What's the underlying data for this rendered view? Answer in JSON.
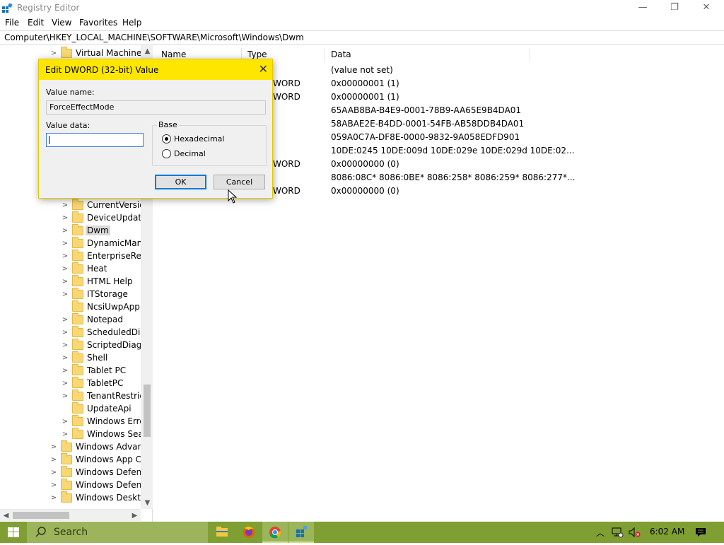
{
  "window": {
    "title": "Registry Editor",
    "controls": {
      "minimize": "—",
      "restore": "❐",
      "close": "✕"
    }
  },
  "menu": [
    "File",
    "Edit",
    "View",
    "Favorites",
    "Help"
  ],
  "address": "Computer\\HKEY_LOCAL_MACHINE\\SOFTWARE\\Microsoft\\Windows\\Dwm",
  "tree": {
    "top_item": "Virtual Machine",
    "items": [
      {
        "label": "CurrentVersion",
        "expandable": true
      },
      {
        "label": "DeviceUpdateC",
        "expandable": true
      },
      {
        "label": "Dwm",
        "expandable": true,
        "selected": true
      },
      {
        "label": "DynamicMana",
        "expandable": true
      },
      {
        "label": "EnterpriseResc",
        "expandable": true
      },
      {
        "label": "Heat",
        "expandable": true
      },
      {
        "label": "HTML Help",
        "expandable": true
      },
      {
        "label": "ITStorage",
        "expandable": true
      },
      {
        "label": "NcsiUwpApp",
        "expandable": false
      },
      {
        "label": "Notepad",
        "expandable": true
      },
      {
        "label": "ScheduledDiag",
        "expandable": true
      },
      {
        "label": "ScriptedDiagn",
        "expandable": true
      },
      {
        "label": "Shell",
        "expandable": true
      },
      {
        "label": "Tablet PC",
        "expandable": true
      },
      {
        "label": "TabletPC",
        "expandable": true
      },
      {
        "label": "TenantRestrict",
        "expandable": true
      },
      {
        "label": "UpdateApi",
        "expandable": false
      },
      {
        "label": "Windows Error",
        "expandable": true
      },
      {
        "label": "Windows Sear",
        "expandable": true
      }
    ],
    "outer_items": [
      {
        "label": "Windows Advanc"
      },
      {
        "label": "Windows App Ce"
      },
      {
        "label": "Windows Defend"
      },
      {
        "label": "Windows Defend"
      },
      {
        "label": "Windows Desktop"
      }
    ]
  },
  "values": {
    "columns": [
      "Name",
      "Type",
      "Data"
    ],
    "rows": [
      {
        "type": "",
        "data": "(value not set)"
      },
      {
        "type": "WORD",
        "data": "0x00000001 (1)"
      },
      {
        "type": "WORD",
        "data": "0x00000001 (1)"
      },
      {
        "type": "",
        "data": "65AAB8BA-B4E9-0001-78B9-AA65E9B4DA01"
      },
      {
        "type": "",
        "data": "58ABAE2E-B4DD-0001-54FB-AB58DDB4DA01"
      },
      {
        "type": "",
        "data": "059A0C7A-DF8E-0000-9832-9A058EDFD901"
      },
      {
        "type": "",
        "data": "10DE:0245 10DE:009d 10DE:029e 10DE:029d 10DE:02..."
      },
      {
        "type": "WORD",
        "data": "0x00000000 (0)"
      },
      {
        "type": "",
        "data": "8086:08C* 8086:0BE* 8086:258* 8086:259* 8086:277*..."
      },
      {
        "type": "WORD",
        "data": "0x00000000 (0)"
      }
    ]
  },
  "dialog": {
    "title": "Edit DWORD (32-bit) Value",
    "close": "✕",
    "value_name_label": "Value name:",
    "value_name": "ForceEffectMode",
    "value_data_label": "Value data:",
    "value_data": "",
    "base_label": "Base",
    "radio_hex": "Hexadecimal",
    "radio_dec": "Decimal",
    "base_selected": "Hexadecimal",
    "ok": "OK",
    "cancel": "Cancel"
  },
  "taskbar": {
    "search_placeholder": "Search",
    "time": "6:02 AM",
    "color": "#7f9f33"
  }
}
